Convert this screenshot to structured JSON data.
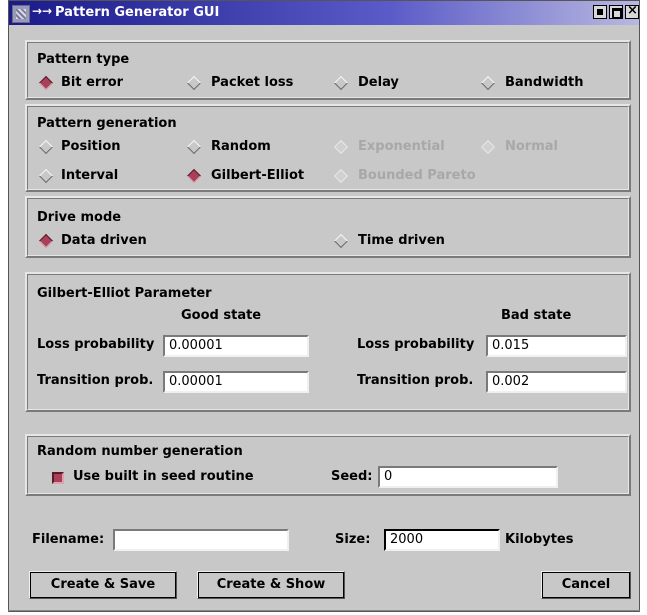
{
  "window": {
    "title": "Pattern Generator GUI",
    "title_arrow": "→→"
  },
  "pattern_type": {
    "heading": "Pattern type",
    "options": [
      "Bit error",
      "Packet loss",
      "Delay",
      "Bandwidth"
    ],
    "selected": "Bit error"
  },
  "pattern_generation": {
    "heading": "Pattern generation",
    "options": [
      "Position",
      "Random",
      "Exponential",
      "Normal",
      "Interval",
      "Gilbert-Elliot",
      "Bounded Pareto"
    ],
    "disabled": [
      "Exponential",
      "Normal",
      "Bounded Pareto"
    ],
    "selected": "Gilbert-Elliot"
  },
  "drive_mode": {
    "heading": "Drive mode",
    "options": [
      "Data driven",
      "Time driven"
    ],
    "selected": "Data driven"
  },
  "ge_params": {
    "heading": "Gilbert-Elliot Parameter",
    "good_state_label": "Good state",
    "bad_state_label": "Bad state",
    "loss_prob_label": "Loss probability",
    "transition_prob_label": "Transition prob.",
    "good_loss": "0.00001",
    "good_transition": "0.00001",
    "bad_loss": "0.015",
    "bad_transition": "0.002"
  },
  "rng": {
    "heading": "Random number generation",
    "use_builtin_label": "Use built in seed routine",
    "use_builtin_checked": true,
    "seed_label": "Seed:",
    "seed_value": "0"
  },
  "footer": {
    "filename_label": "Filename:",
    "filename_value": "",
    "size_label": "Size:",
    "size_value": "2000",
    "size_unit": "Kilobytes"
  },
  "buttons": {
    "create_save": "Create & Save",
    "create_show": "Create & Show",
    "cancel": "Cancel"
  },
  "colors": {
    "title_bg": "#1a1a8a",
    "window_bg": "#c8c8c8",
    "radio_selected": "#a8405a"
  }
}
